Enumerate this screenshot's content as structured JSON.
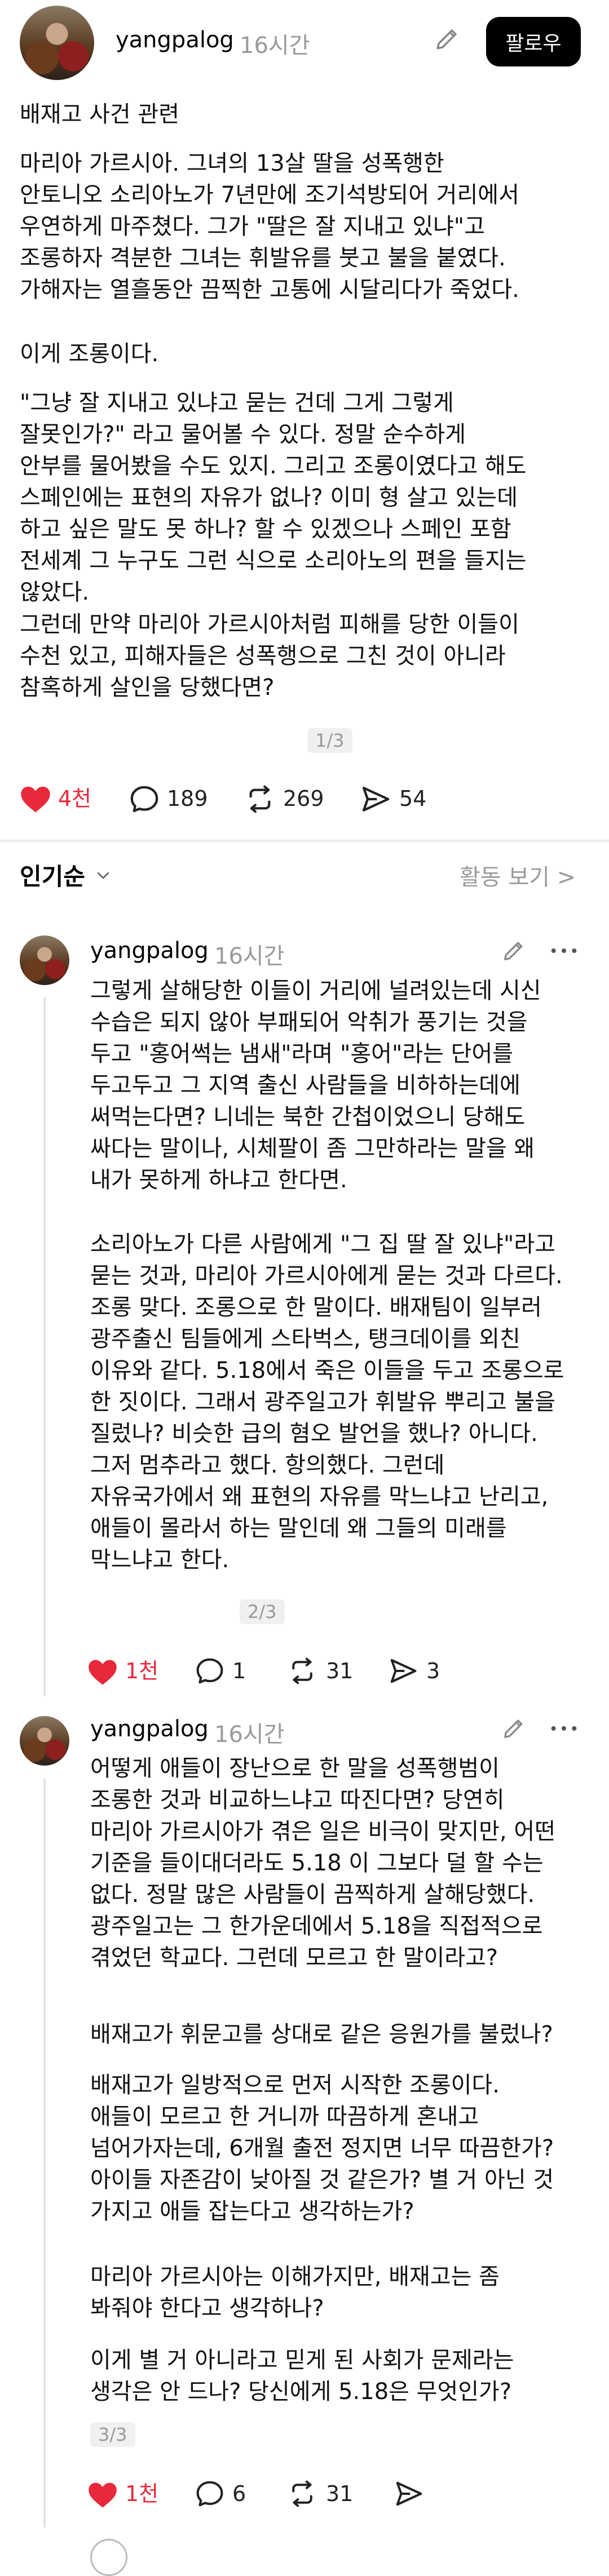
{
  "post": {
    "username": "yangpalog",
    "time": "16시간",
    "follow_label": "팔로우",
    "title": "배재고 사건 관련",
    "paragraphs": [
      "마리아 가르시아. 그녀의 13살 딸을 성폭행한\n안토니오 소리아노가 7년만에 조기석방되어 거리에서\n우연하게 마주쳤다. 그가 \"딸은 잘 지내고 있냐\"고\n조롱하자 격분한 그녀는 휘발유를 붓고 불을 붙였다.\n가해자는 열흘동안 끔찍한 고통에 시달리다가 죽었다.",
      "이게 조롱이다.",
      "\"그냥 잘 지내고 있냐고 묻는 건데 그게 그렇게\n잘못인가?\" 라고 물어볼 수 있다. 정말 순수하게\n안부를 물어봤을 수도 있지. 그리고 조롱이였다고 해도\n스페인에는 표현의 자유가 없나? 이미 형 살고 있는데\n하고 싶은 말도 못 하나? 할 수 있겠으나 스페인 포함\n전세계 그 누구도 그런 식으로 소리아노의 편을 들지는\n않았다.",
      "그런데 만약 마리아 가르시아처럼 피해를 당한 이들이\n수천 있고, 피해자들은 성폭행으로 그친 것이 아니라\n참혹하게 살인을 당했다면?"
    ],
    "page": "1/3",
    "likes": "4천",
    "comments": "189",
    "reposts": "269",
    "shares": "54"
  },
  "sort": {
    "label": "인기순",
    "activity_label": "활동 보기 >"
  },
  "replies": [
    {
      "username": "yangpalog",
      "time": "16시간",
      "paragraphs": [
        "그렇게 살해당한 이들이 거리에 널려있는데 시신\n수습은 되지 않아 부패되어 악취가 풍기는 것을\n두고 \"홍어썩는 냄새\"라며 \"홍어\"라는 단어를\n두고두고 그 지역 출신 사람들을 비하하는데에\n써먹는다면? 니네는 북한 간첩이었으니 당해도\n싸다는 말이나, 시체팔이 좀 그만하라는 말을 왜\n내가 못하게 하냐고 한다면.",
        "소리아노가 다른 사람에게 \"그 집 딸 잘 있냐\"라고\n묻는 것과, 마리아 가르시아에게 묻는 것과 다르다.\n조롱 맞다. 조롱으로 한 말이다. 배재팀이 일부러\n광주출신 팀들에게 스타벅스, 탱크데이를 외친\n이유와 같다. 5.18에서 죽은 이들을 두고 조롱으로\n한 짓이다. 그래서 광주일고가 휘발유 뿌리고 불을\n질렀나? 비슷한 급의 혐오 발언을 했나? 아니다.\n그저 멈추라고 했다. 항의했다. 그런데\n자유국가에서 왜 표현의 자유를 막느냐고 난리고,\n애들이 몰라서 하는 말인데 왜 그들의 미래를\n막느냐고 한다."
      ],
      "page": "2/3",
      "likes": "1천",
      "comments": "1",
      "reposts": "31",
      "shares": "3"
    },
    {
      "username": "yangpalog",
      "time": "16시간",
      "paragraphs": [
        "어떻게 애들이 장난으로 한 말을 성폭행범이\n조롱한 것과 비교하느냐고 따진다면? 당연히\n마리아 가르시아가 겪은 일은 비극이 맞지만, 어떤\n기준을 들이대더라도 5.18 이 그보다 덜 할 수는\n없다. 정말 많은 사람들이 끔찍하게 살해당했다.\n광주일고는 그 한가운데에서 5.18을 직접적으로\n겪었던 학교다. 그런데 모르고 한 말이라고?",
        "배재고가 휘문고를 상대로 같은 응원가를 불렀나?",
        "배재고가 일방적으로 먼저 시작한 조롱이다.\n애들이 모르고 한 거니까 따끔하게 혼내고\n넘어가자는데, 6개월 출전 정지면 너무 따끔한가?\n아이들 자존감이 낮아질 것 같은가? 별 거 아닌 것\n가지고 애들 잡는다고 생각하는가?",
        "마리아 가르시아는 이해가지만, 배재고는 좀\n봐줘야 한다고 생각하나?",
        "이게 별 거 아니라고 믿게 된 사회가 문제라는\n생각은 안 드나? 당신에게 5.18은 무엇인가?"
      ],
      "page": "3/3",
      "likes": "1천",
      "comments": "6",
      "reposts": "31"
    }
  ],
  "colors": {
    "like_red": "#e8283b",
    "muted": "#9a9a9a",
    "follow_bg": "#000000"
  },
  "icons": [
    "pencil-icon",
    "more-icon",
    "heart-icon",
    "comment-icon",
    "repost-icon",
    "share-icon",
    "chevron-down-icon"
  ]
}
